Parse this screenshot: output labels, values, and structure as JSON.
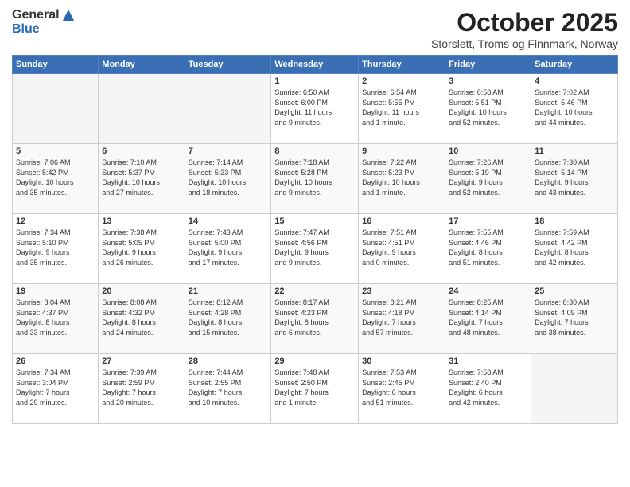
{
  "header": {
    "logo_general": "General",
    "logo_blue": "Blue",
    "month_title": "October 2025",
    "location": "Storslett, Troms og Finnmark, Norway"
  },
  "weekdays": [
    "Sunday",
    "Monday",
    "Tuesday",
    "Wednesday",
    "Thursday",
    "Friday",
    "Saturday"
  ],
  "weeks": [
    [
      {
        "day": "",
        "info": ""
      },
      {
        "day": "",
        "info": ""
      },
      {
        "day": "",
        "info": ""
      },
      {
        "day": "1",
        "info": "Sunrise: 6:50 AM\nSunset: 6:00 PM\nDaylight: 11 hours\nand 9 minutes."
      },
      {
        "day": "2",
        "info": "Sunrise: 6:54 AM\nSunset: 5:55 PM\nDaylight: 11 hours\nand 1 minute."
      },
      {
        "day": "3",
        "info": "Sunrise: 6:58 AM\nSunset: 5:51 PM\nDaylight: 10 hours\nand 52 minutes."
      },
      {
        "day": "4",
        "info": "Sunrise: 7:02 AM\nSunset: 5:46 PM\nDaylight: 10 hours\nand 44 minutes."
      }
    ],
    [
      {
        "day": "5",
        "info": "Sunrise: 7:06 AM\nSunset: 5:42 PM\nDaylight: 10 hours\nand 35 minutes."
      },
      {
        "day": "6",
        "info": "Sunrise: 7:10 AM\nSunset: 5:37 PM\nDaylight: 10 hours\nand 27 minutes."
      },
      {
        "day": "7",
        "info": "Sunrise: 7:14 AM\nSunset: 5:33 PM\nDaylight: 10 hours\nand 18 minutes."
      },
      {
        "day": "8",
        "info": "Sunrise: 7:18 AM\nSunset: 5:28 PM\nDaylight: 10 hours\nand 9 minutes."
      },
      {
        "day": "9",
        "info": "Sunrise: 7:22 AM\nSunset: 5:23 PM\nDaylight: 10 hours\nand 1 minute."
      },
      {
        "day": "10",
        "info": "Sunrise: 7:26 AM\nSunset: 5:19 PM\nDaylight: 9 hours\nand 52 minutes."
      },
      {
        "day": "11",
        "info": "Sunrise: 7:30 AM\nSunset: 5:14 PM\nDaylight: 9 hours\nand 43 minutes."
      }
    ],
    [
      {
        "day": "12",
        "info": "Sunrise: 7:34 AM\nSunset: 5:10 PM\nDaylight: 9 hours\nand 35 minutes."
      },
      {
        "day": "13",
        "info": "Sunrise: 7:38 AM\nSunset: 5:05 PM\nDaylight: 9 hours\nand 26 minutes."
      },
      {
        "day": "14",
        "info": "Sunrise: 7:43 AM\nSunset: 5:00 PM\nDaylight: 9 hours\nand 17 minutes."
      },
      {
        "day": "15",
        "info": "Sunrise: 7:47 AM\nSunset: 4:56 PM\nDaylight: 9 hours\nand 9 minutes."
      },
      {
        "day": "16",
        "info": "Sunrise: 7:51 AM\nSunset: 4:51 PM\nDaylight: 9 hours\nand 0 minutes."
      },
      {
        "day": "17",
        "info": "Sunrise: 7:55 AM\nSunset: 4:46 PM\nDaylight: 8 hours\nand 51 minutes."
      },
      {
        "day": "18",
        "info": "Sunrise: 7:59 AM\nSunset: 4:42 PM\nDaylight: 8 hours\nand 42 minutes."
      }
    ],
    [
      {
        "day": "19",
        "info": "Sunrise: 8:04 AM\nSunset: 4:37 PM\nDaylight: 8 hours\nand 33 minutes."
      },
      {
        "day": "20",
        "info": "Sunrise: 8:08 AM\nSunset: 4:32 PM\nDaylight: 8 hours\nand 24 minutes."
      },
      {
        "day": "21",
        "info": "Sunrise: 8:12 AM\nSunset: 4:28 PM\nDaylight: 8 hours\nand 15 minutes."
      },
      {
        "day": "22",
        "info": "Sunrise: 8:17 AM\nSunset: 4:23 PM\nDaylight: 8 hours\nand 6 minutes."
      },
      {
        "day": "23",
        "info": "Sunrise: 8:21 AM\nSunset: 4:18 PM\nDaylight: 7 hours\nand 57 minutes."
      },
      {
        "day": "24",
        "info": "Sunrise: 8:25 AM\nSunset: 4:14 PM\nDaylight: 7 hours\nand 48 minutes."
      },
      {
        "day": "25",
        "info": "Sunrise: 8:30 AM\nSunset: 4:09 PM\nDaylight: 7 hours\nand 38 minutes."
      }
    ],
    [
      {
        "day": "26",
        "info": "Sunrise: 7:34 AM\nSunset: 3:04 PM\nDaylight: 7 hours\nand 29 minutes."
      },
      {
        "day": "27",
        "info": "Sunrise: 7:39 AM\nSunset: 2:59 PM\nDaylight: 7 hours\nand 20 minutes."
      },
      {
        "day": "28",
        "info": "Sunrise: 7:44 AM\nSunset: 2:55 PM\nDaylight: 7 hours\nand 10 minutes."
      },
      {
        "day": "29",
        "info": "Sunrise: 7:48 AM\nSunset: 2:50 PM\nDaylight: 7 hours\nand 1 minute."
      },
      {
        "day": "30",
        "info": "Sunrise: 7:53 AM\nSunset: 2:45 PM\nDaylight: 6 hours\nand 51 minutes."
      },
      {
        "day": "31",
        "info": "Sunrise: 7:58 AM\nSunset: 2:40 PM\nDaylight: 6 hours\nand 42 minutes."
      },
      {
        "day": "",
        "info": ""
      }
    ]
  ]
}
